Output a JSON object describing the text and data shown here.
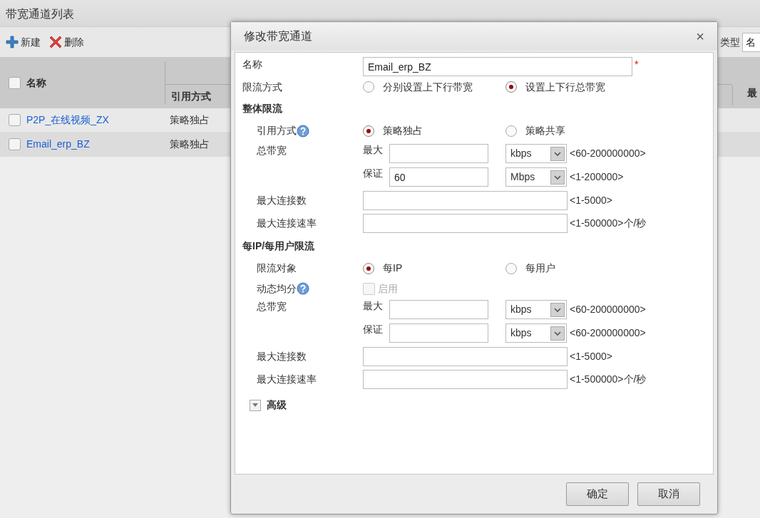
{
  "page": {
    "title": "带宽通道列表",
    "toolbar": [
      {
        "kind": "add",
        "label": "新建"
      },
      {
        "kind": "delete",
        "label": "删除"
      }
    ],
    "filter": {
      "label": "类型",
      "value": "名"
    }
  },
  "table": {
    "columns": [
      {
        "label": "名称"
      },
      {
        "label": "引用方式"
      },
      {
        "label": "最"
      }
    ],
    "header_checked": false,
    "rows": [
      {
        "name": "P2P_在线视频_ZX",
        "mode": "策略独占",
        "checked": false,
        "selected": false
      },
      {
        "name": "Email_erp_BZ",
        "mode": "策略独占",
        "checked": false,
        "selected": true
      }
    ]
  },
  "dialog": {
    "title": "修改带宽通道",
    "close": "×",
    "name_field": {
      "label": "名称",
      "value": "Email_erp_BZ",
      "required_mark": "*"
    },
    "limit_mode": {
      "label": "限流方式",
      "options": [
        {
          "label": "分别设置上下行带宽",
          "selected": false
        },
        {
          "label": "设置上下行总带宽",
          "selected": true
        }
      ]
    },
    "sections": [
      {
        "title": "整体限流",
        "rows": [
          {
            "kind": "radio",
            "label": "引用方式",
            "help": true,
            "options": [
              {
                "label": "策略独占",
                "selected": true
              },
              {
                "label": "策略共享",
                "selected": false
              }
            ]
          },
          {
            "kind": "bandwidth",
            "label": "总带宽",
            "lines": [
              {
                "label": "最大",
                "unit": "kbps",
                "range": "<60-200000000>"
              },
              {
                "label": "保证",
                "value": "60",
                "unit": "Mbps",
                "range": "<1-200000>"
              }
            ]
          },
          {
            "kind": "input",
            "label": "最大连接数",
            "hint": "<1-5000>"
          },
          {
            "kind": "input",
            "label": "最大连接速率",
            "hint": "<1-500000>个/秒"
          }
        ]
      },
      {
        "title": "每IP/每用户限流",
        "rows": [
          {
            "kind": "radio",
            "label": "限流对象",
            "help": false,
            "options": [
              {
                "label": "每IP",
                "selected": true
              },
              {
                "label": "每用户",
                "selected": false
              }
            ]
          },
          {
            "kind": "checkbox",
            "label": "动态均分",
            "help": true,
            "text": "启用",
            "checked": false,
            "disabled": true
          },
          {
            "kind": "bandwidth",
            "label": "总带宽",
            "lines": [
              {
                "label": "最大",
                "unit": "kbps",
                "range": "<60-200000000>"
              },
              {
                "label": "保证",
                "unit": "kbps",
                "range": "<60-200000000>"
              }
            ]
          },
          {
            "kind": "input",
            "label": "最大连接数",
            "hint": "<1-5000>"
          },
          {
            "kind": "input",
            "label": "最大连接速率",
            "hint": "<1-500000>个/秒"
          }
        ]
      }
    ],
    "advanced": {
      "label": "高级",
      "expanded": false
    },
    "buttons": [
      "确定",
      "取消"
    ]
  }
}
